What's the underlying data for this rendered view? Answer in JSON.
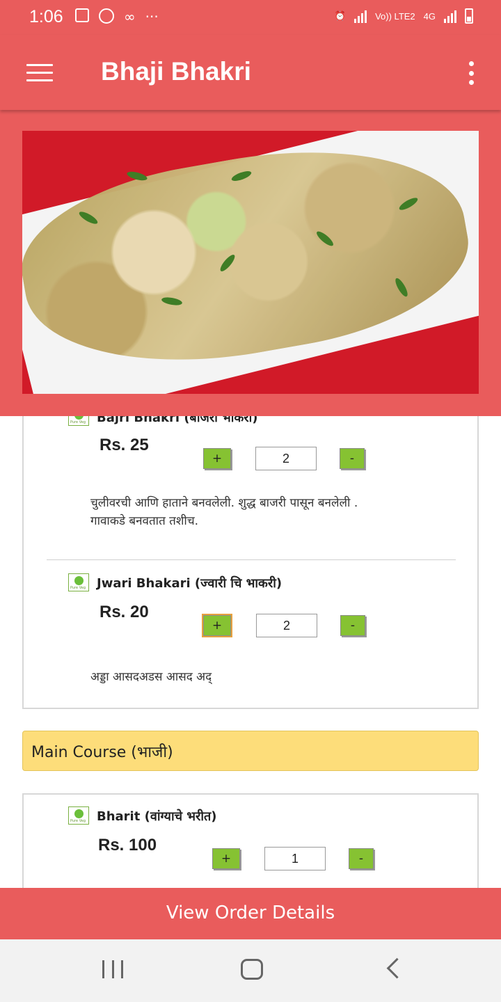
{
  "status_bar": {
    "time": "1:06",
    "more": "···",
    "network_volte": "Vo)) LTE2",
    "network_type": "4G"
  },
  "app_bar": {
    "title": "Bhaji Bhakri"
  },
  "items": [
    {
      "name": "Bajri Bhakri (बाजरी भाकरी)",
      "veg_label": "Pure Veg",
      "price": "Rs. 25",
      "plus": "+",
      "qty": "2",
      "minus": "-",
      "desc_line1": "चुलीवरची आणि हाताने बनवलेली. शुद्ध बाजरी पासून बनलेली .",
      "desc_line2": "गावाकडे बनवतात तशीच."
    },
    {
      "name": "Jwari Bhakari (ज्वारी चि भाकरी)",
      "veg_label": "Pure Veg",
      "price": "Rs. 20",
      "plus": "+",
      "qty": "2",
      "minus": "-",
      "desc_line1": "अड्डा आसदअडस आसद अद्"
    },
    {
      "name": "Bharit (वांग्याचे भरीत)",
      "veg_label": "Pure Veg",
      "price": "Rs. 100",
      "plus": "+",
      "qty": "1",
      "minus": "-"
    }
  ],
  "sections": {
    "main_course": "Main Course (भाजी)"
  },
  "footer": {
    "view_order": "View Order Details"
  },
  "colors": {
    "primary": "#e95c5c",
    "section_bg": "#fddd7a",
    "button_green": "#86c232"
  }
}
